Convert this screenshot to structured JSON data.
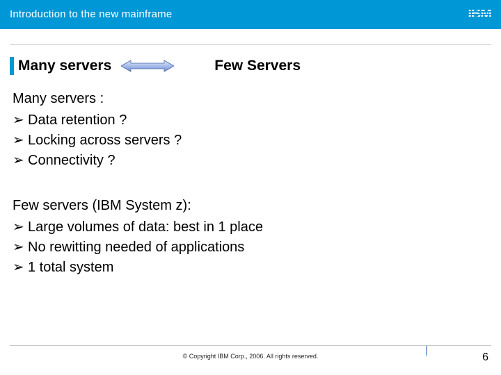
{
  "header": {
    "title": "Introduction to the new mainframe",
    "brand": "IBM"
  },
  "heading": {
    "left": "Many servers",
    "right": "Few Servers",
    "relation_icon": "double-arrow"
  },
  "groups": [
    {
      "title": "Many servers :",
      "items": [
        "Data retention ?",
        "Locking across servers ?",
        "Connectivity ?"
      ]
    },
    {
      "title": "Few servers (IBM System z):",
      "items": [
        "Large volumes of data: best in 1 place",
        "No rewitting needed of applications",
        "1 total system"
      ]
    }
  ],
  "bullet_glyph": "➢",
  "footer": {
    "copyright": "© Copyright IBM Corp., 2006. All rights reserved.",
    "page": "6"
  },
  "colors": {
    "brand_blue": "#0097d6"
  }
}
